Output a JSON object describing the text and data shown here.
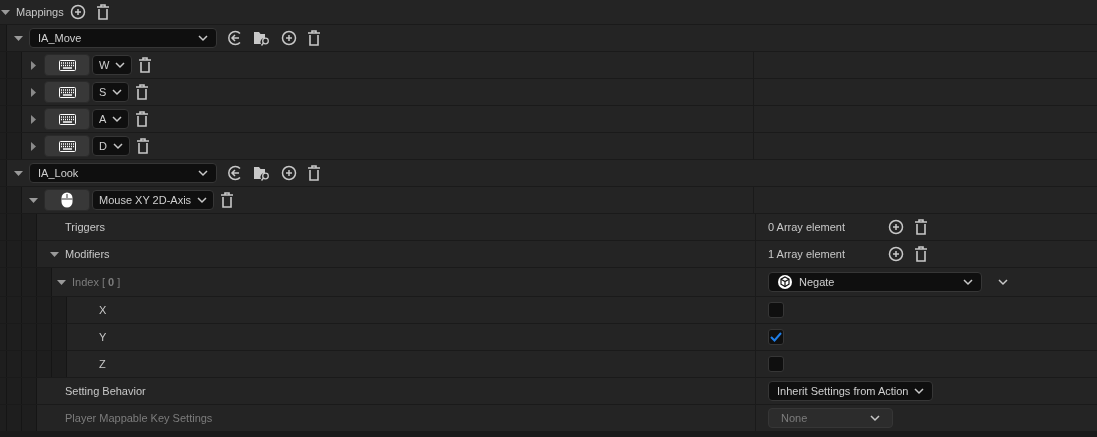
{
  "mappings": {
    "label": "Mappings",
    "expanded": true,
    "actions": [
      {
        "action": "IA_Move",
        "expanded": true,
        "keys": [
          {
            "kind": "keyboard",
            "key": "W",
            "expanded": false
          },
          {
            "kind": "keyboard",
            "key": "S",
            "expanded": false
          },
          {
            "kind": "keyboard",
            "key": "A",
            "expanded": false
          },
          {
            "kind": "keyboard",
            "key": "D",
            "expanded": false
          }
        ]
      },
      {
        "action": "IA_Look",
        "expanded": true,
        "keys": [
          {
            "kind": "mouse",
            "key": "Mouse XY 2D-Axis",
            "expanded": true,
            "properties": [
              {
                "kind": "array",
                "label": "Triggers",
                "value": "0 Array element"
              },
              {
                "kind": "array",
                "label": "Modifiers",
                "value": "1 Array element",
                "expanded": true,
                "children": [
                  {
                    "kind": "object",
                    "label": "Index [ **0** ]",
                    "value": "Negate",
                    "expanded": true,
                    "children": [
                      {
                        "kind": "checkbox",
                        "label": "X",
                        "checked": false
                      },
                      {
                        "kind": "checkbox",
                        "label": "Y",
                        "checked": true
                      },
                      {
                        "kind": "checkbox",
                        "label": "Z",
                        "checked": false
                      }
                    ]
                  }
                ]
              },
              {
                "kind": "dropdown",
                "label": "Setting Behavior",
                "value": "Inherit Settings from Action",
                "disabled": false
              },
              {
                "kind": "dropdown",
                "label": "Player Mappable Key Settings",
                "value": "None",
                "disabled": true
              }
            ]
          }
        ]
      }
    ]
  }
}
